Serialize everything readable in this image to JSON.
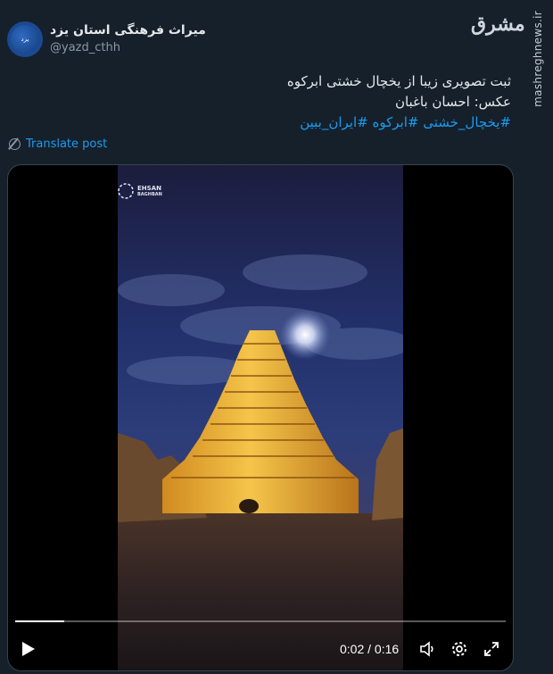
{
  "author": {
    "name": "میراث فرهنگی استان یزد",
    "handle": "@yazd_cthh",
    "avatar_text": "یزد"
  },
  "watermark": {
    "logo_text": "مشرق",
    "site": "mashreghnews.ir"
  },
  "post": {
    "line1": "ثبت تصویری زیبا از یخچال خشتی ابرکوه",
    "line2": "عکس: احسان باغبان",
    "hashtags": [
      "#یخچال_خشتی",
      "#ابرکوه",
      "#ایران_ببین"
    ]
  },
  "translate_label": "Translate post",
  "video": {
    "logo_text": "EHSAN",
    "logo_sub": "BAGHBAN",
    "current_time": "0:02",
    "separator": "/",
    "duration": "0:16",
    "progress": 0.1
  },
  "icons": {
    "play": "play-icon",
    "volume": "volume-icon",
    "settings": "gear-icon",
    "fullscreen": "fullscreen-icon",
    "translate": "translate-icon"
  },
  "colors": {
    "background": "#15202b",
    "link": "#1d9bf0",
    "text": "#e7e9ea",
    "muted": "#8b98a5"
  }
}
